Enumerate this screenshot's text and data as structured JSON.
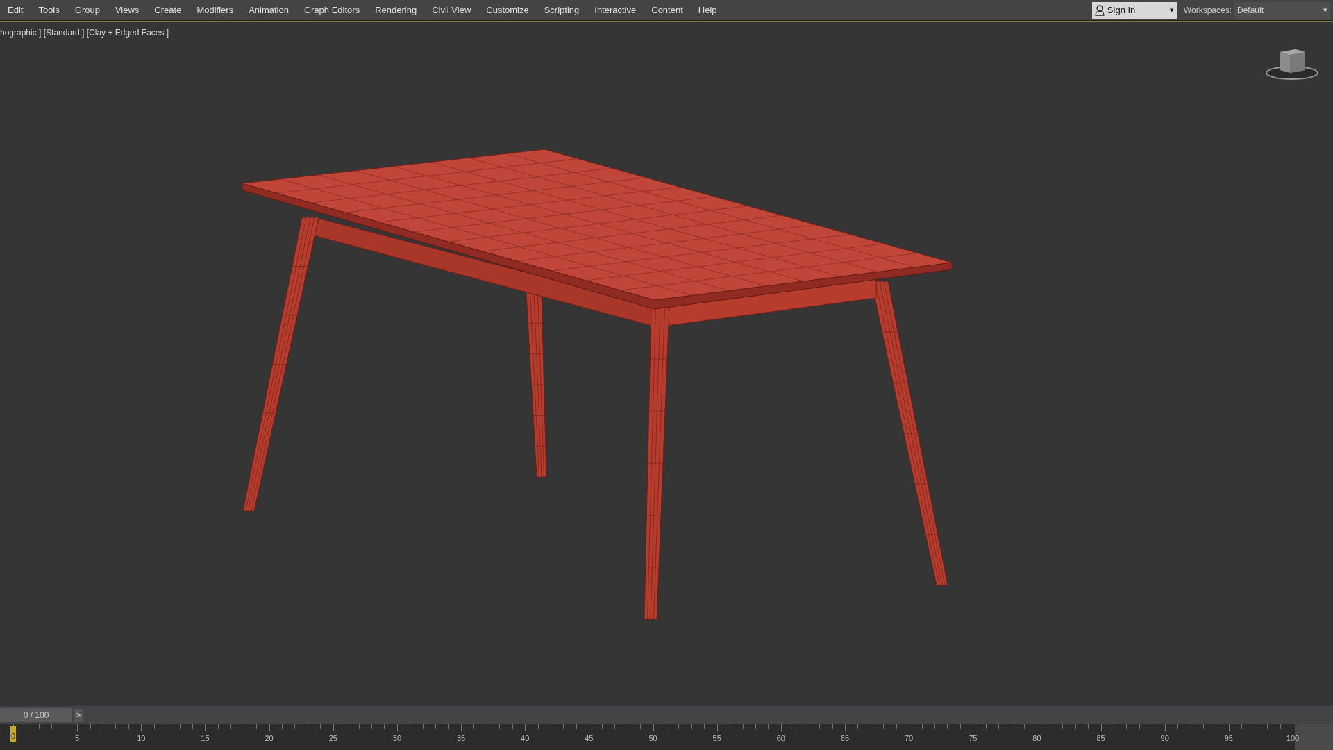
{
  "menu_bar": {
    "items": [
      "Edit",
      "Tools",
      "Group",
      "Views",
      "Create",
      "Modifiers",
      "Animation",
      "Graph Editors",
      "Rendering",
      "Civil View",
      "Customize",
      "Scripting",
      "Interactive",
      "Content",
      "Help"
    ]
  },
  "sign_in": {
    "label": "Sign In",
    "caret": "▾"
  },
  "workspaces": {
    "label": "Workspaces:",
    "value": "Default",
    "caret": "▾"
  },
  "viewport": {
    "label": "hographic ] [Standard ] [Clay + Edged Faces ]"
  },
  "time_slider": {
    "reading": "0 / 100",
    "next_button": ">",
    "level": 0
  },
  "timeline": {
    "ticks": [
      {
        "label": "0",
        "selected": true
      },
      {
        "label": "5",
        "selected": false
      },
      {
        "label": "10",
        "selected": false
      },
      {
        "label": "15",
        "selected": false
      },
      {
        "label": "20",
        "selected": false
      },
      {
        "label": "25",
        "selected": false
      },
      {
        "label": "30",
        "selected": false
      },
      {
        "label": "35",
        "selected": false
      },
      {
        "label": "40",
        "selected": false
      },
      {
        "label": "45",
        "selected": false
      },
      {
        "label": "50",
        "selected": false
      },
      {
        "label": "55",
        "selected": false
      },
      {
        "label": "60",
        "selected": false
      },
      {
        "label": "65",
        "selected": false
      },
      {
        "label": "70",
        "selected": false
      },
      {
        "label": "75",
        "selected": false
      },
      {
        "label": "80",
        "selected": false
      },
      {
        "label": "85",
        "selected": false
      },
      {
        "label": "90",
        "selected": false
      },
      {
        "label": "95",
        "selected": false
      },
      {
        "label": "100",
        "selected": false
      }
    ]
  }
}
